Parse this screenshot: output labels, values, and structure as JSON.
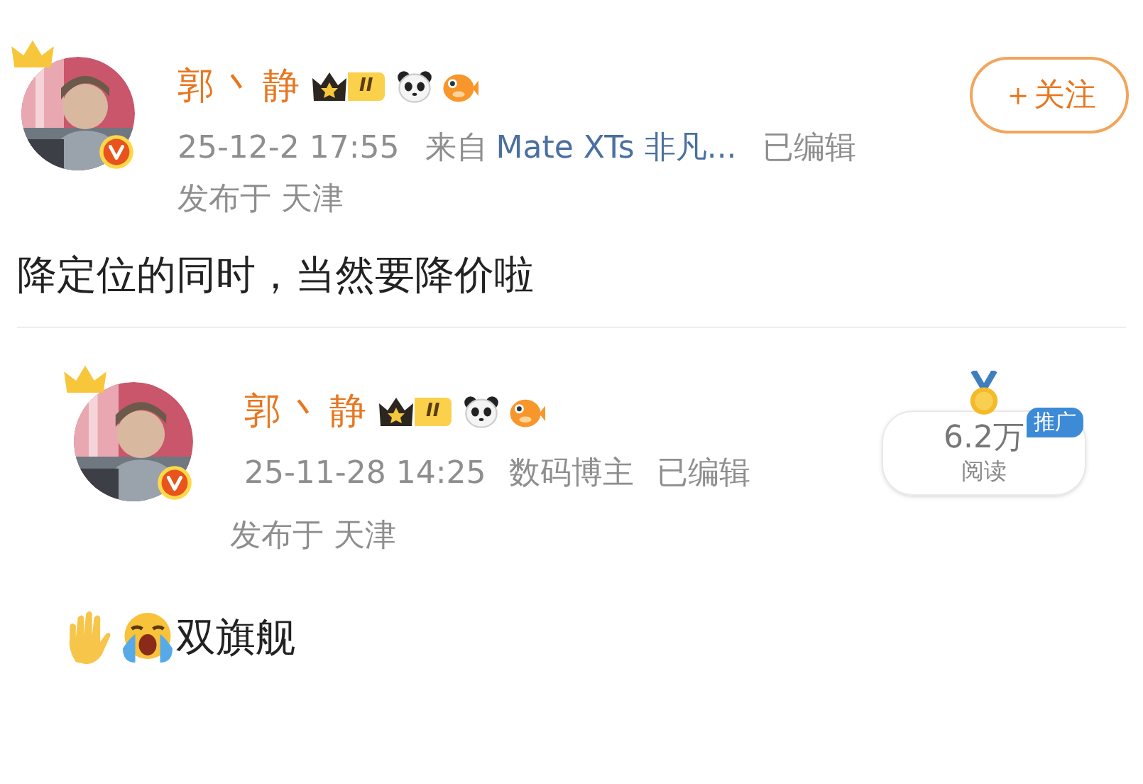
{
  "post": {
    "author": "郭丶静",
    "level_badge": "II",
    "follow_button": "＋关注",
    "time": "25-12-2 17:55",
    "source_prefix": "来自",
    "source": "Mate XTs 非凡...",
    "edited": "已编辑",
    "location": "发布于 天津",
    "text": "降定位的同时，当然要降价啦"
  },
  "quoted_post": {
    "author": "郭丶静",
    "level_badge": "II",
    "time": "25-11-28 14:25",
    "role": "数码博主",
    "edited": "已编辑",
    "location": "发布于 天津",
    "text": "双旗舰",
    "reads": {
      "count": "6.2万",
      "label": "阅读",
      "tag": "推广"
    }
  }
}
